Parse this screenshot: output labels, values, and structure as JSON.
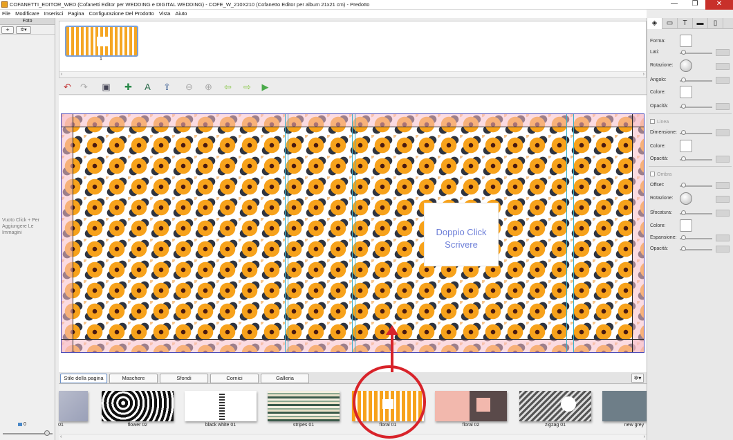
{
  "window": {
    "title": "COFANETTI_EDITOR_WED (Cofanetti Editor per WEDDING e DIGITAL WEDDING) - COFE_W_210X210 (Cofanetto Editor per album 21x21 cm) - Predotto",
    "minimize": "—",
    "maximize": "❐",
    "close": "✕"
  },
  "menu": [
    "File",
    "Modificare",
    "Inserisci",
    "Pagina",
    "Configurazione Del Prodotto",
    "Vista",
    "Aiuto"
  ],
  "left_panel": {
    "header": "Foto",
    "add_label": "+",
    "settings_label": "✲▾",
    "empty_text": "Vuoto Click + Per Aggiungere Le Immagini",
    "photo_count": "0"
  },
  "thumbnail": {
    "page_number": "1"
  },
  "canvas": {
    "textbox": "Doppio Click Scrivere"
  },
  "tabs": [
    "Stile della pagina",
    "Maschere",
    "Sfondi",
    "Cornici",
    "Galleria"
  ],
  "gallery": {
    "items": [
      {
        "label": "01",
        "style": "plain"
      },
      {
        "label": "flower 02",
        "style": "flower"
      },
      {
        "label": "black white 01",
        "style": "bw"
      },
      {
        "label": "stripes 01",
        "style": "stripes"
      },
      {
        "label": "floral 01",
        "style": "floral1"
      },
      {
        "label": "floral 02",
        "style": "floral2"
      },
      {
        "label": "zigzag 01",
        "style": "zigzag"
      },
      {
        "label": "new grey",
        "style": "grey"
      }
    ]
  },
  "properties": {
    "forma": "Forma:",
    "lati": "Lati:",
    "rotazione": "Rotazione:",
    "angolo": "Angolo:",
    "colore": "Colore:",
    "opacita": "Opacità:",
    "linea_check": "Linea",
    "dimensione": "Dimensione:",
    "colore2": "Colore:",
    "opacita2": "Opacità:",
    "ombra_check": "Ombra",
    "offset": "Offset:",
    "rotazione2": "Rotazione:",
    "sfocatura": "Sfocatura:",
    "colore3": "Colore:",
    "espansione": "Espansione:",
    "opacita3": "Opacità:"
  },
  "colors": {
    "accent_red": "#d8232a",
    "pattern_orange": "#f7a21b",
    "text_blue": "#6d7fd8"
  }
}
